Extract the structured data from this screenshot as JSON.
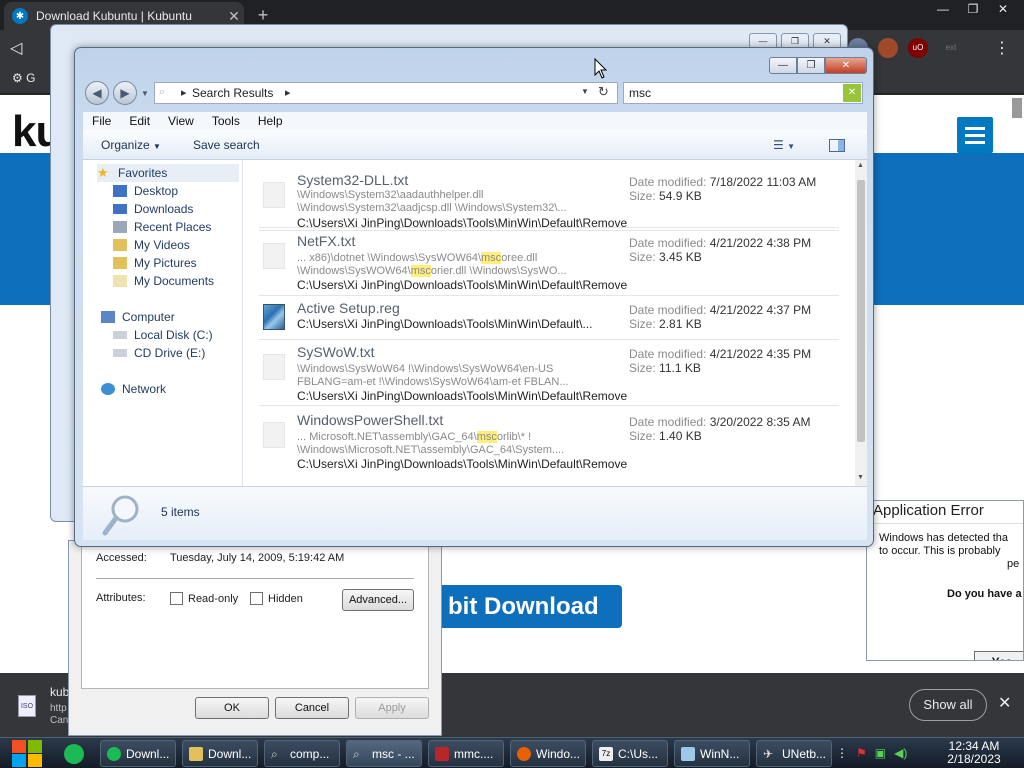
{
  "browser": {
    "tab_title": "Download Kubuntu | Kubuntu",
    "tab_close": "✕",
    "new_tab": "+",
    "win_min": "—",
    "win_max": "❐",
    "win_close": "✕",
    "back": "◁",
    "menu": "⋮",
    "bookmark_fragment": "G",
    "site_logo": "ku",
    "download_button": "bit Download",
    "ext_labels": {
      "ublock": "uO",
      "ext": "ext"
    }
  },
  "download_bar": {
    "name": "kub",
    "url": "http",
    "status": "Can",
    "icon": "ISO",
    "show_all": "Show all",
    "close": "✕"
  },
  "properties_dialog": {
    "accessed_label": "Accessed:",
    "accessed_value": "Tuesday, July 14, 2009, 5:19:42 AM",
    "attributes_label": "Attributes:",
    "readonly": "Read-only",
    "hidden": "Hidden",
    "advanced": "Advanced...",
    "ok": "OK",
    "cancel": "Cancel",
    "apply": "Apply"
  },
  "app_error": {
    "title": "Application Error",
    "line1": "Windows has detected tha",
    "line2": "to occur. This is probably",
    "line3": "pe",
    "question": "Do you have a",
    "yes": "Yes"
  },
  "explorer": {
    "address_path": "Search Results",
    "search_query": "msc",
    "search_clear": "✕",
    "menu": [
      "File",
      "Edit",
      "View",
      "Tools",
      "Help"
    ],
    "organize": "Organize",
    "save_search": "Save search",
    "nav": {
      "favorites": "Favorites",
      "desktop": "Desktop",
      "downloads": "Downloads",
      "recent": "Recent Places",
      "videos": "My Videos",
      "pictures": "My Pictures",
      "documents": "My Documents",
      "computer": "Computer",
      "local_disk": "Local Disk (C:)",
      "cd_drive": "CD Drive (E:)",
      "network": "Network"
    },
    "date_label": "Date modified:",
    "size_label": "Size:",
    "results": [
      {
        "name": "System32-DLL.txt",
        "snip1": "\\Windows\\System32\\aadauthhelper.dll",
        "snip2": "\\Windows\\System32\\aadjcsp.dll \\Windows\\System32\\...",
        "path": "C:\\Users\\Xi JinPing\\Downloads\\Tools\\MinWin\\Default\\Remove",
        "date": "7/18/2022 11:03 AM",
        "size": "54.9 KB"
      },
      {
        "name": "NetFX.txt",
        "snip1_a": "... x86)\\dotnet \\Windows\\SysWOW64\\",
        "snip1_hl": "msc",
        "snip1_b": "oree.dll",
        "snip2_a": "\\Windows\\SysWOW64\\",
        "snip2_hl": "msc",
        "snip2_b": "orier.dll \\Windows\\SysWO...",
        "path": "C:\\Users\\Xi JinPing\\Downloads\\Tools\\MinWin\\Default\\Remove",
        "date": "4/21/2022 4:38 PM",
        "size": "3.45 KB"
      },
      {
        "name": "Active Setup.reg",
        "path": "C:\\Users\\Xi JinPing\\Downloads\\Tools\\MinWin\\Default\\...",
        "date": "4/21/2022 4:37 PM",
        "size": "2.81 KB"
      },
      {
        "name": "SySWoW.txt",
        "snip1": "\\Windows\\SysWoW64 !\\Windows\\SysWoW64\\en-US",
        "snip2": "FBLANG=am-et !\\Windows\\SysWoW64\\am-et FBLAN...",
        "path": "C:\\Users\\Xi JinPing\\Downloads\\Tools\\MinWin\\Default\\Remove",
        "date": "4/21/2022 4:35 PM",
        "size": "11.1 KB"
      },
      {
        "name": "WindowsPowerShell.txt",
        "snip1_a": "... Microsoft.NET\\assembly\\GAC_64\\",
        "snip1_hl": "msc",
        "snip1_b": "orlib\\* !",
        "snip2": "\\Windows\\Microsoft.NET\\assembly\\GAC_64\\System....",
        "path": "C:\\Users\\Xi JinPing\\Downloads\\Tools\\MinWin\\Default\\Remove",
        "date": "3/20/2022 8:35 AM",
        "size": "1.40 KB"
      }
    ],
    "item_count": "5 items"
  },
  "taskbar": {
    "tasks": [
      "Downl...",
      "Downl...",
      "comp...",
      "msc - ...",
      "mmc....",
      "Windo...",
      "C:\\Us...",
      "WinN...",
      "UNetb..."
    ],
    "clock_time": "12:34 AM",
    "clock_date": "2/18/2023"
  },
  "colors": {
    "accent_blue": "#0e6fbd",
    "search_highlight": "#ffef7a",
    "close_red": "#c23e22"
  }
}
